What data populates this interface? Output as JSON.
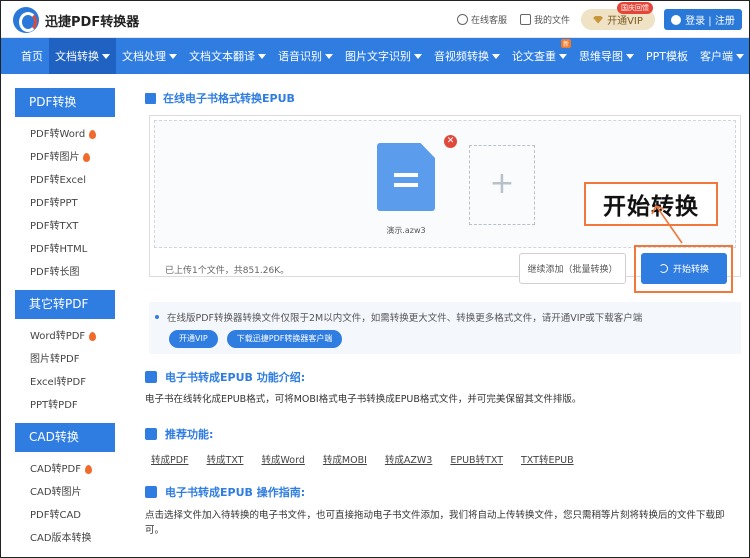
{
  "header": {
    "logo_text": "迅捷PDF转换器",
    "service_label": "在线客服",
    "my_files_label": "我的文件",
    "vip_label": "开通VIP",
    "vip_tag": "国庆回馈",
    "login_label": "登录 | 注册"
  },
  "nav": {
    "items": [
      {
        "label": "首页"
      },
      {
        "label": "文档转换"
      },
      {
        "label": "文档处理"
      },
      {
        "label": "文档文本翻译"
      },
      {
        "label": "语音识别"
      },
      {
        "label": "图片文字识别"
      },
      {
        "label": "音视频转换"
      },
      {
        "label": "论文查重"
      },
      {
        "label": "思维导图"
      },
      {
        "label": "PPT模板"
      },
      {
        "label": "客户端"
      }
    ],
    "new_badge": "新"
  },
  "sidebar": {
    "groups": [
      {
        "title": "PDF转换",
        "items": [
          "PDF转Word",
          "PDF转图片",
          "PDF转Excel",
          "PDF转PPT",
          "PDF转TXT",
          "PDF转HTML",
          "PDF转长图"
        ]
      },
      {
        "title": "其它转PDF",
        "items": [
          "Word转PDF",
          "图片转PDF",
          "Excel转PDF",
          "PPT转PDF"
        ]
      },
      {
        "title": "CAD转换",
        "items": [
          "CAD转PDF",
          "CAD转图片",
          "PDF转CAD",
          "CAD版本转换"
        ]
      }
    ]
  },
  "main": {
    "title": "在线电子书格式转换EPUB",
    "file_name": "演示.azw3",
    "uploaded_text": "已上传1个文件，共851.26K。",
    "continue_label": "继续添加（批量转换）",
    "start_label": "开始转换",
    "callout_text": "开始转换",
    "notice": "在线版PDF转换器转换文件仅限于2M以内文件，如需转换更大文件、转换更多格式文件，请开通VIP或下载客户端",
    "notice_btn1": "开通VIP",
    "notice_btn2": "下载迅捷PDF转换器客户端",
    "intro_title": "电子书转成EPUB 功能介绍:",
    "intro_text": "电子书在线转化成EPUB格式，可将MOBI格式电子书转换成EPUB格式文件，并可完美保留其文件排版。",
    "rec_title": "推荐功能:",
    "rec_links": [
      "转成PDF",
      "转成TXT",
      "转成Word",
      "转成MOBI",
      "转成AZW3",
      "EPUB转TXT",
      "TXT转EPUB"
    ],
    "guide_title": "电子书转成EPUB 操作指南:",
    "guide_text": "点击选择文件加入待转换的电子书文件，也可直接拖动电子书文件添加，我们将自动上传转换文件，您只需稍等片刻将转换后的文件下载即可。"
  },
  "colors": {
    "brand": "#2f7de1",
    "highlight": "#f0783c"
  }
}
